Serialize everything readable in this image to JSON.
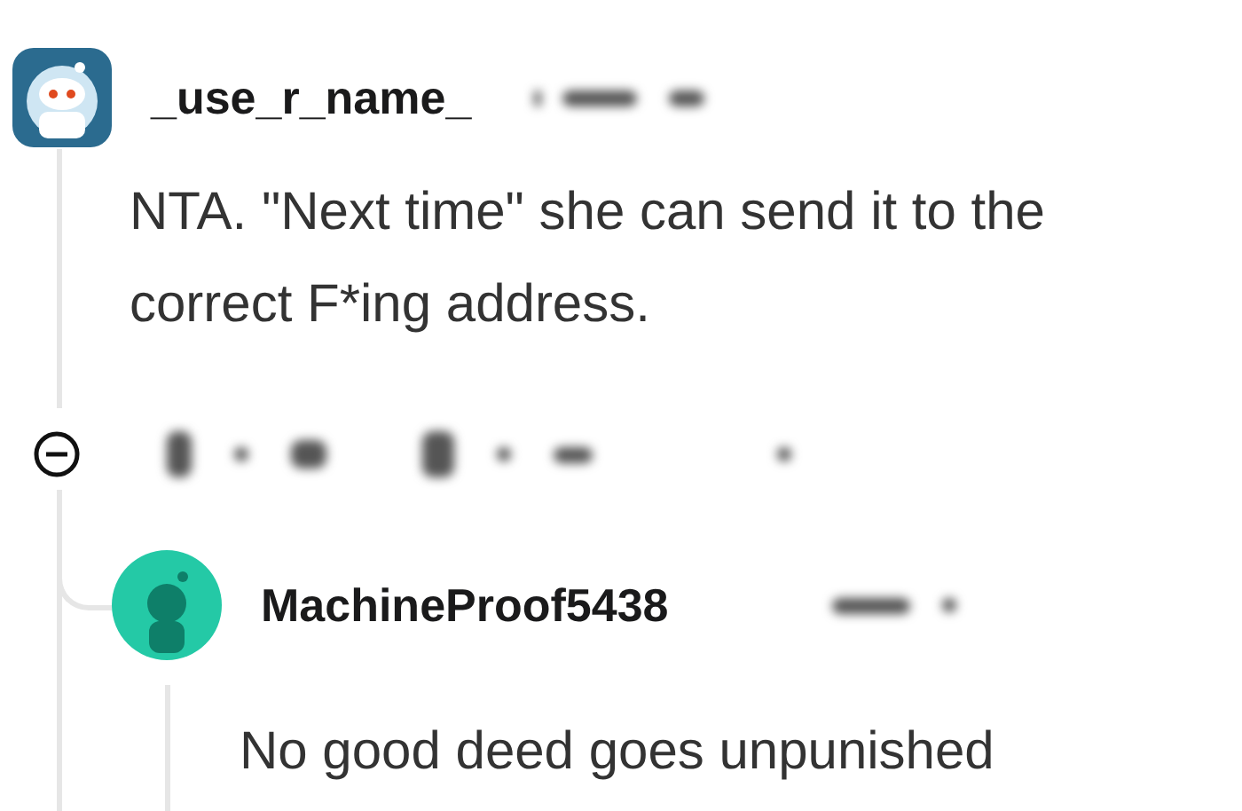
{
  "comment": {
    "username": "_use_r_name_",
    "body": "NTA. \"Next time\" she can send it to the correct F*ing address.",
    "collapsed": false,
    "reply": {
      "username": "MachineProof5438",
      "body": "No good deed goes unpunished"
    }
  }
}
